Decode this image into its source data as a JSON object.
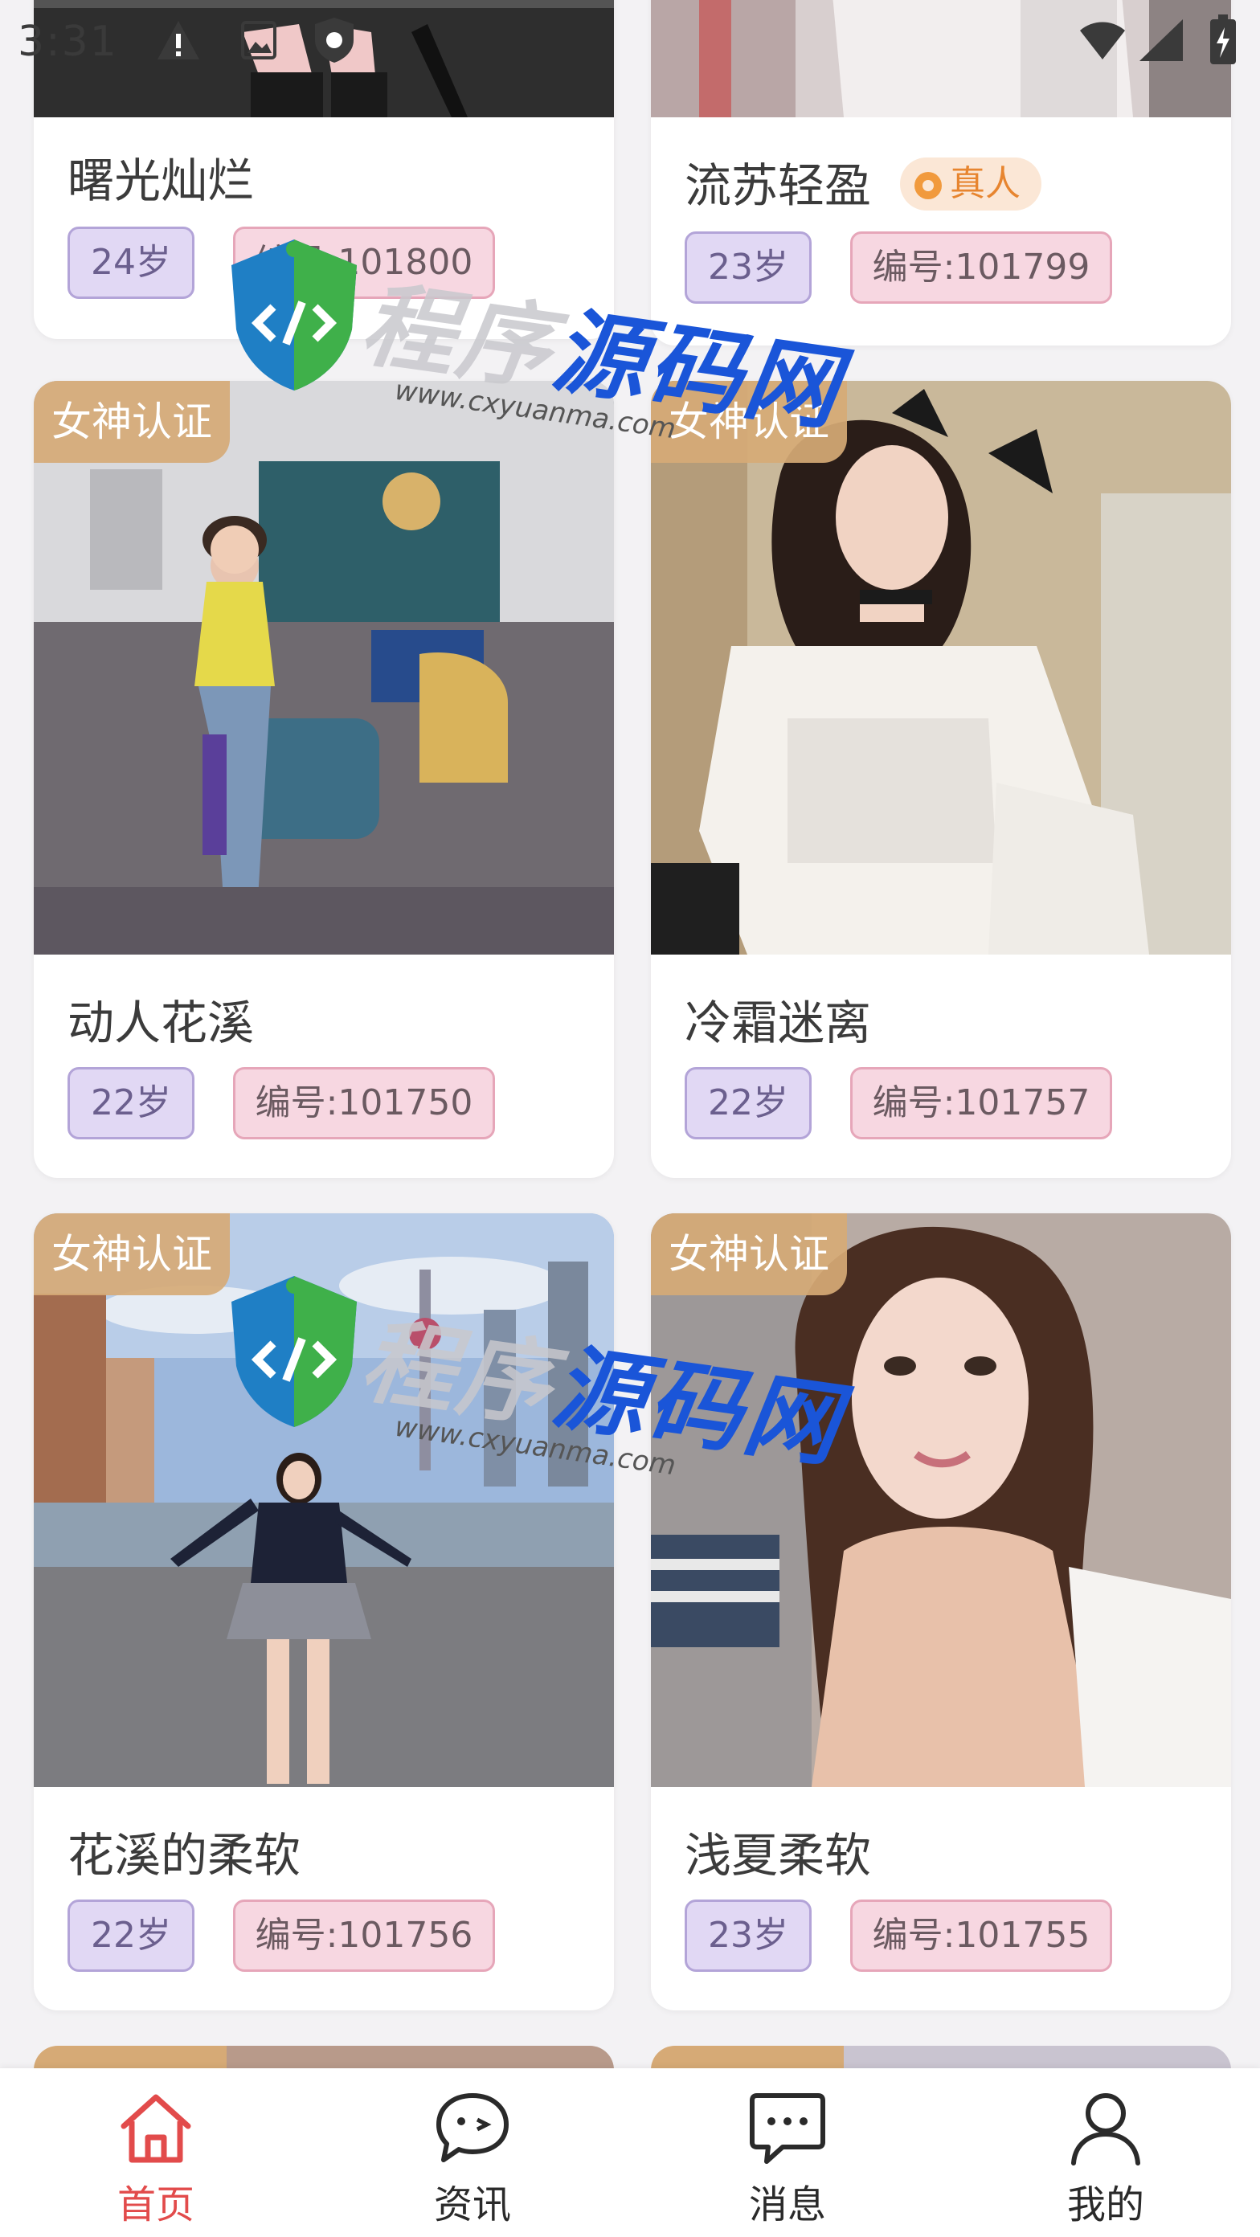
{
  "status_bar": {
    "time": "3:31"
  },
  "cards": [
    {
      "name": "曙光灿烂",
      "age": "24岁",
      "id": "编号:101800",
      "real_label": ""
    },
    {
      "name": "流苏轻盈",
      "age": "23岁",
      "id": "编号:101799",
      "real_label": "真人"
    },
    {
      "name": "动人花溪",
      "age": "22岁",
      "id": "编号:101750",
      "cert": "女神认证"
    },
    {
      "name": "冷霜迷离",
      "age": "22岁",
      "id": "编号:101757",
      "cert": "女神认证"
    },
    {
      "name": "花溪的柔软",
      "age": "22岁",
      "id": "编号:101756",
      "cert": "女神认证"
    },
    {
      "name": "浅夏柔软",
      "age": "23岁",
      "id": "编号:101755",
      "cert": "女神认证"
    }
  ],
  "watermark": {
    "title_part1": "程序",
    "title_part2": "源码网",
    "url": "www.cxyuanma.com"
  },
  "nav": {
    "items": [
      {
        "label": "首页",
        "icon": "home-icon",
        "active": true
      },
      {
        "label": "资讯",
        "icon": "chat-bubble-icon",
        "active": false
      },
      {
        "label": "消息",
        "icon": "message-icon",
        "active": false
      },
      {
        "label": "我的",
        "icon": "profile-icon",
        "active": false
      }
    ]
  },
  "colors": {
    "active_nav": "#e24b4b",
    "age_pill_bg": "#e1d8f4",
    "id_pill_bg": "#f7d7e1",
    "cert_badge_bg": "#d6aa76",
    "real_badge_text": "#e7852f"
  }
}
